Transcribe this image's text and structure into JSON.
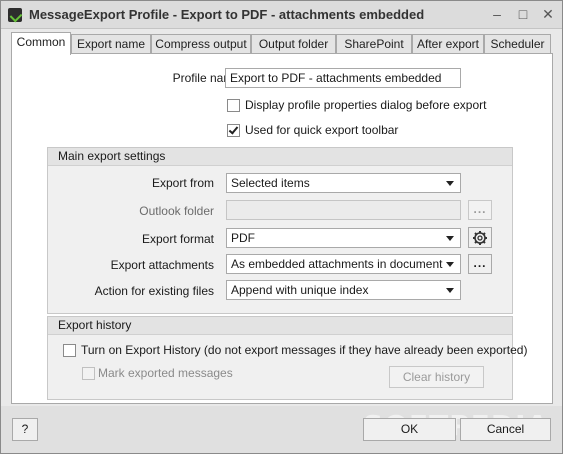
{
  "window": {
    "title": "MessageExport Profile - Export to PDF - attachments embedded",
    "minimize_glyph": "–",
    "restore_glyph": "□",
    "close_glyph": "✕"
  },
  "tabs": [
    {
      "label": "Common",
      "active": true
    },
    {
      "label": "Export name",
      "active": false
    },
    {
      "label": "Compress output",
      "active": false
    },
    {
      "label": "Output folder",
      "active": false
    },
    {
      "label": "SharePoint",
      "active": false
    },
    {
      "label": "After export",
      "active": false
    },
    {
      "label": "Scheduler",
      "active": false
    }
  ],
  "common": {
    "profile_name_label": "Profile name",
    "profile_name_value": "Export to PDF - attachments embedded",
    "display_props_label": "Display profile properties dialog before export",
    "display_props_checked": false,
    "quick_toolbar_label": "Used for quick export toolbar",
    "quick_toolbar_checked": true
  },
  "main_export": {
    "header": "Main export settings",
    "export_from_label": "Export from",
    "export_from_value": "Selected items",
    "outlook_folder_label": "Outlook folder",
    "outlook_folder_value": "",
    "browse_label": "...",
    "export_format_label": "Export format",
    "export_format_value": "PDF",
    "export_attachments_label": "Export attachments",
    "export_attachments_value": "As embedded attachments in document",
    "attachments_more_label": "...",
    "existing_files_label": "Action for existing files",
    "existing_files_value": "Append with unique index"
  },
  "export_history": {
    "header": "Export history",
    "turn_on_label": "Turn on Export History (do not export messages if they have already been exported)",
    "turn_on_checked": false,
    "mark_exported_label": "Mark exported messages",
    "mark_exported_checked": false,
    "clear_history_label": "Clear history"
  },
  "footer": {
    "help_label": "?",
    "ok_label": "OK",
    "cancel_label": "Cancel",
    "watermark": "SOFTPEDIA"
  },
  "icons": {
    "app": "app-icon",
    "settings": "gear-icon"
  }
}
